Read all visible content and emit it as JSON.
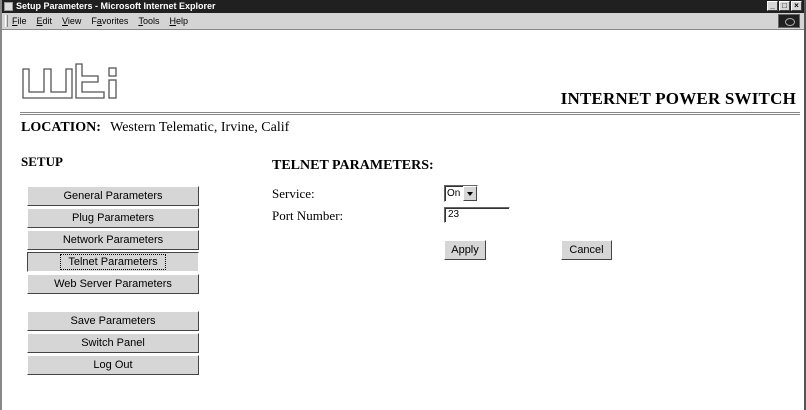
{
  "window": {
    "title": "Setup Parameters - Microsoft Internet Explorer",
    "controls": [
      "minimize",
      "maximize",
      "close"
    ]
  },
  "menu": [
    {
      "u": "F",
      "rest": "ile"
    },
    {
      "u": "E",
      "rest": "dit"
    },
    {
      "u": "V",
      "rest": "iew"
    },
    {
      "pre": "F",
      "u": "a",
      "rest": "vorites"
    },
    {
      "u": "T",
      "rest": "ools"
    },
    {
      "u": "H",
      "rest": "elp"
    }
  ],
  "header": {
    "logo_text": "wti",
    "product_title": "INTERNET POWER SWITCH"
  },
  "location": {
    "label": "LOCATION:",
    "value": "Western Telematic, Irvine, Calif"
  },
  "sidebar": {
    "heading": "SETUP",
    "items": [
      {
        "label": "General Parameters"
      },
      {
        "label": "Plug Parameters"
      },
      {
        "label": "Network Parameters"
      },
      {
        "label": "Telnet Parameters",
        "active": true
      },
      {
        "label": "Web Server Parameters"
      },
      {
        "label": "Save Parameters"
      },
      {
        "label": "Switch Panel"
      },
      {
        "label": "Log Out"
      }
    ]
  },
  "form": {
    "heading": "TELNET PARAMETERS:",
    "service_label": "Service:",
    "service_value": "On",
    "port_label": "Port Number:",
    "port_value": "23",
    "apply_label": "Apply",
    "cancel_label": "Cancel"
  }
}
